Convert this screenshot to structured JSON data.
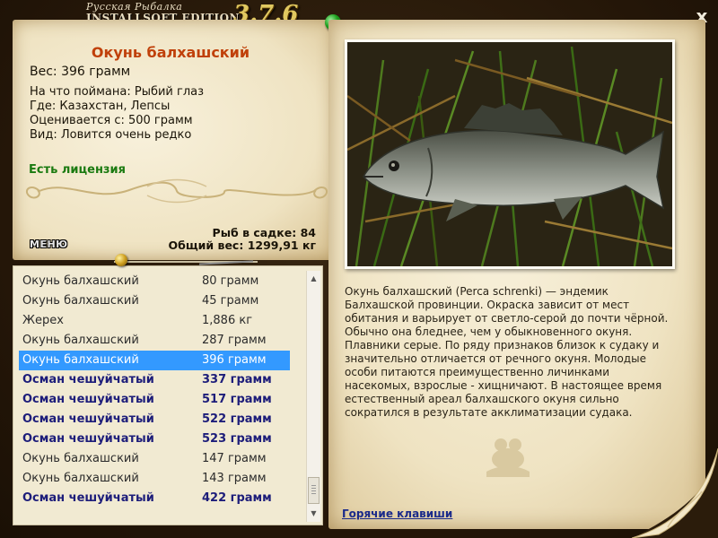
{
  "app": {
    "title_line1": "Русская Рыбалка",
    "title_line2": "INSTALLSOFT EDITION",
    "version": "3.7.6",
    "close_label": "x"
  },
  "fish": {
    "name": "Окунь балхашский",
    "weight": "Вес: 396 грамм",
    "bait": "На что поймана: Рыбий глаз",
    "where": "Где: Казахстан, Лепсы",
    "value": "Оценивается с: 500 грамм",
    "rarity": "Вид: Ловится очень редко",
    "license": "Есть лицензия"
  },
  "stats": {
    "count": "Рыб в садке: 84",
    "total": "Общий вес: 1299,91 кг"
  },
  "menu_label": "МЕНЮ",
  "catch_list": [
    {
      "name": "Окунь балхашский",
      "weight": "80 грамм",
      "bold": false,
      "selected": false
    },
    {
      "name": "Окунь балхашский",
      "weight": "45 грамм",
      "bold": false,
      "selected": false
    },
    {
      "name": "Жерех",
      "weight": "1,886 кг",
      "bold": false,
      "selected": false
    },
    {
      "name": "Окунь балхашский",
      "weight": "287 грамм",
      "bold": false,
      "selected": false
    },
    {
      "name": "Окунь балхашский",
      "weight": "396 грамм",
      "bold": false,
      "selected": true
    },
    {
      "name": "Осман чешуйчатый",
      "weight": "337 грамм",
      "bold": true,
      "selected": false
    },
    {
      "name": "Осман чешуйчатый",
      "weight": "517 грамм",
      "bold": true,
      "selected": false
    },
    {
      "name": "Осман чешуйчатый",
      "weight": "522 грамм",
      "bold": true,
      "selected": false
    },
    {
      "name": "Осман чешуйчатый",
      "weight": "523 грамм",
      "bold": true,
      "selected": false
    },
    {
      "name": "Окунь балхашский",
      "weight": "147 грамм",
      "bold": false,
      "selected": false
    },
    {
      "name": "Окунь балхашский",
      "weight": "143 грамм",
      "bold": false,
      "selected": false
    },
    {
      "name": "Осман чешуйчатый",
      "weight": "422 грамм",
      "bold": true,
      "selected": false
    }
  ],
  "description": "Окунь балхашский (Perca schrenki) — эндемик Балхашской провинции. Окраска зависит от мест обитания и варьирует от светло-серой до почти чёрной. Обычно она бледнее, чем у обыкновенного окуня. Плавники серые. По ряду признаков близок к судаку и значительно отличается от речного окуня. Молодые особи питаются преимущественно личинками насекомых, взрослые - хищничают. В настоящее время естественный ареал балхашского окуня сильно сократился в результате акклиматизации судака.",
  "hotkeys_label": "Горячие клавиши",
  "colors": {
    "title_accent": "#c0400a",
    "license_green": "#1a7a10",
    "selection": "#3399ff",
    "bold_entry": "#1d1d7a",
    "link": "#1a2a8a"
  }
}
